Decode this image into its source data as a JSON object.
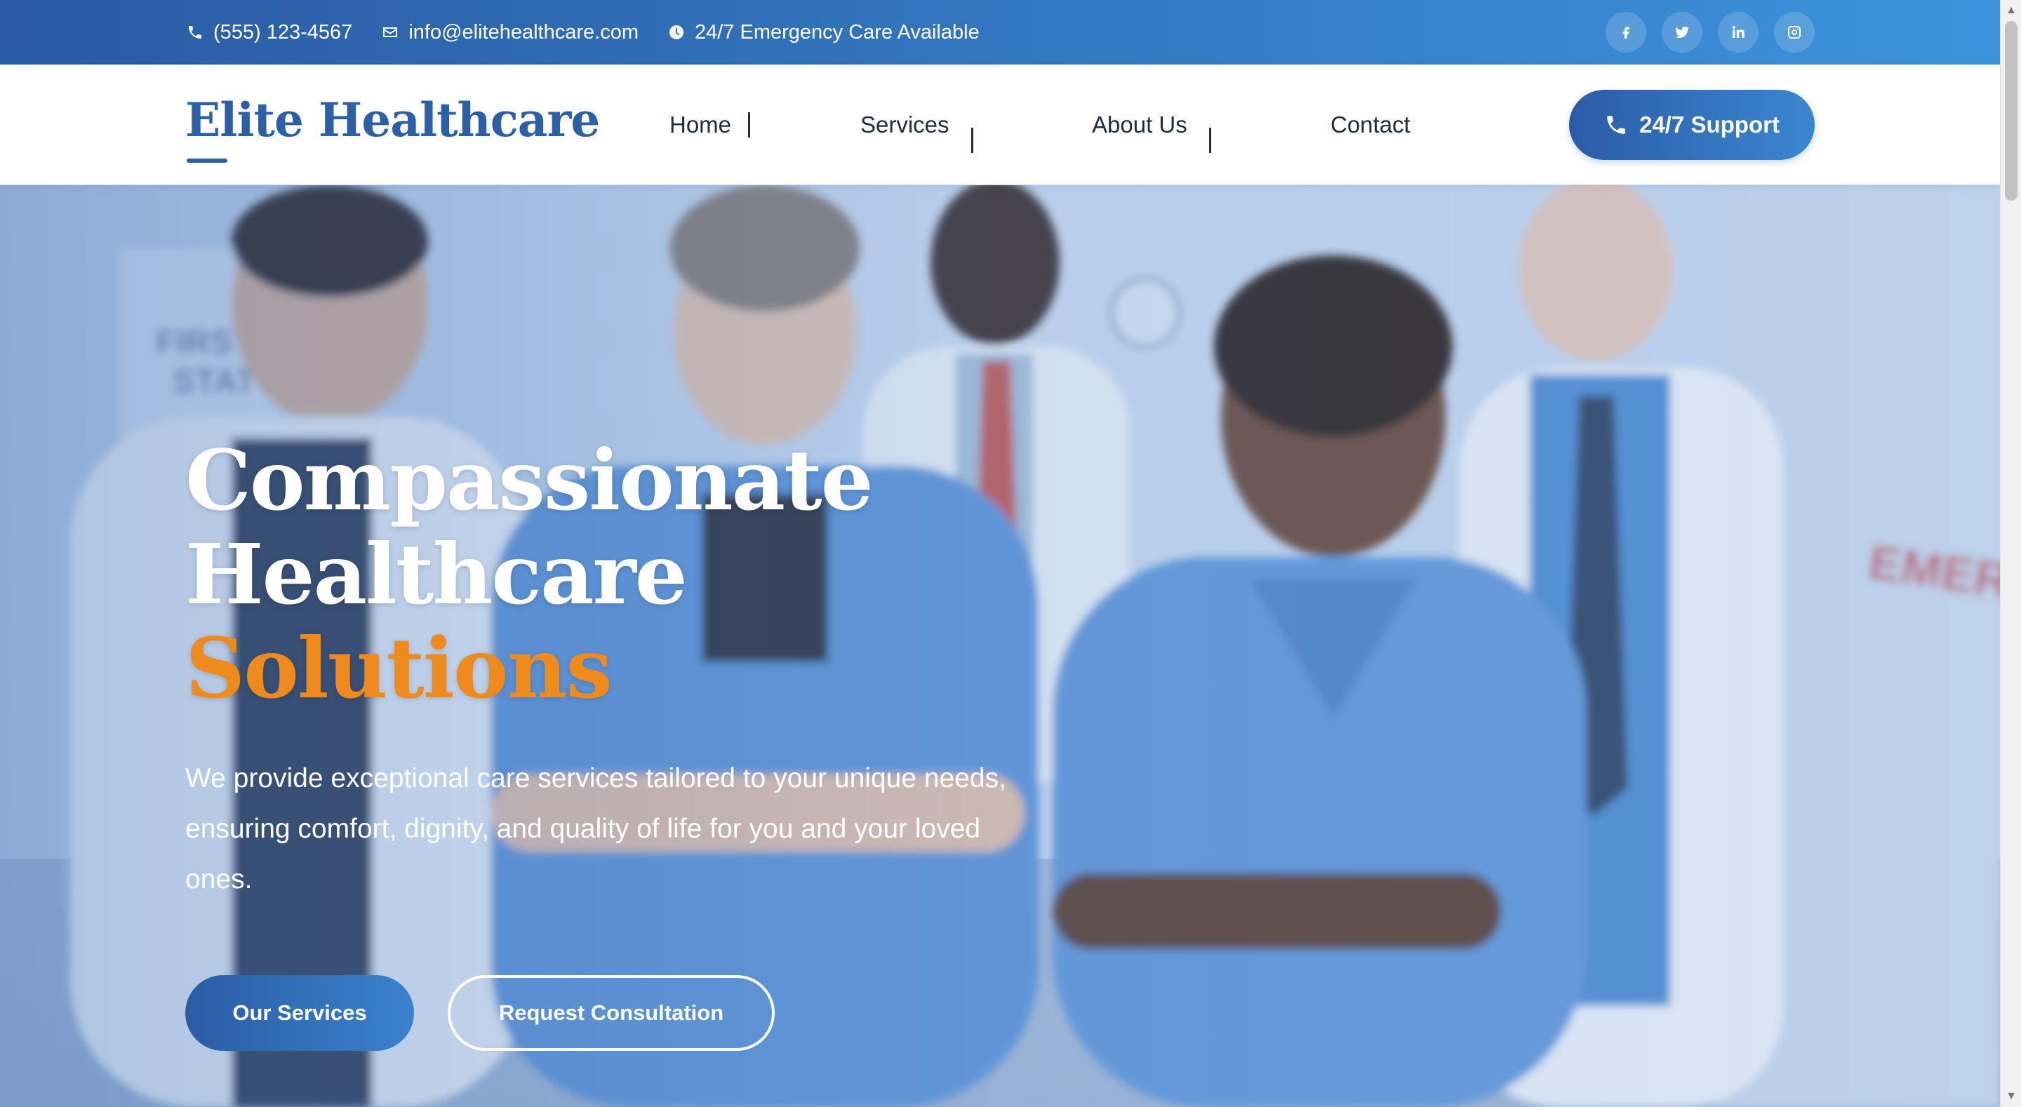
{
  "topbar": {
    "phone": "(555) 123-4567",
    "email": "info@elitehealthcare.com",
    "emergency": "24/7 Emergency Care Available",
    "socials": [
      "facebook-icon",
      "twitter-icon",
      "linkedin-icon",
      "instagram-icon"
    ]
  },
  "header": {
    "logo": "Elite Healthcare",
    "nav": [
      "Home",
      "Services",
      "About Us",
      "Contact"
    ],
    "support_label": "24/7 Support"
  },
  "hero": {
    "title_line1": "Compassionate",
    "title_line2": "Healthcare",
    "title_accent": "Solutions",
    "description": "We provide exceptional care services tailored to your unique needs, ensuring comfort, dignity, and quality of life for you and your loved ones.",
    "primary_button": "Our Services",
    "secondary_button": "Request Consultation"
  },
  "colors": {
    "brand_blue": "#2c5fa8",
    "accent_orange": "#ef8a1d",
    "topbar_gradient_start": "#2a5aa3",
    "topbar_gradient_end": "#3c93dc"
  }
}
